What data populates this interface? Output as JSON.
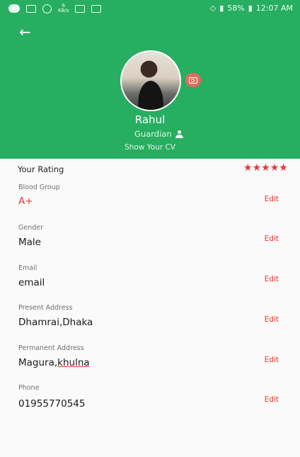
{
  "statusbar": {
    "speed_value": "6",
    "speed_unit": "KB/s",
    "battery_percent": "58%",
    "time": "12:07 AM"
  },
  "header": {
    "name": "Rahul",
    "role": "Guardian",
    "cv_link": "Show Your CV"
  },
  "rating": {
    "label": "Your Rating",
    "stars": 5
  },
  "fields": [
    {
      "label": "Blood Group",
      "value": "A+",
      "edit": "Edit"
    },
    {
      "label": "Gender",
      "value": "Male",
      "edit": "Edit"
    },
    {
      "label": "Email",
      "value": "email",
      "edit": "Edit"
    },
    {
      "label": "Present Address",
      "value": "Dhamrai,Dhaka",
      "edit": "Edit"
    },
    {
      "label": "Permanent Address",
      "value_part1": "Magura,",
      "value_part2": "khulna",
      "edit": "Edit"
    },
    {
      "label": "Phone",
      "value": "01955770545",
      "edit": "Edit"
    }
  ],
  "colors": {
    "header_bg": "#27ae60",
    "accent_red": "#e53935"
  }
}
